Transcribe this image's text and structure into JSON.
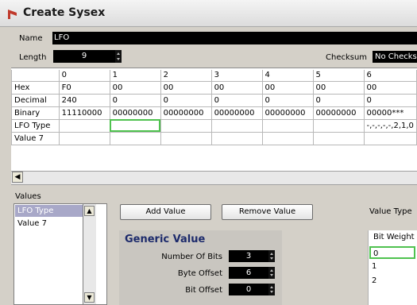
{
  "window": {
    "title": "Create Sysex"
  },
  "name": {
    "label": "Name",
    "value": "LFO"
  },
  "length": {
    "label": "Length",
    "value": "9"
  },
  "checksum": {
    "label": "Checksum",
    "value": "No Checksum"
  },
  "grid": {
    "columns": [
      "0",
      "1",
      "2",
      "3",
      "4",
      "5",
      "6"
    ],
    "rows": [
      {
        "label": "Hex",
        "cells": [
          "F0",
          "00",
          "00",
          "00",
          "00",
          "00",
          "00"
        ]
      },
      {
        "label": "Decimal",
        "cells": [
          "240",
          "0",
          "0",
          "0",
          "0",
          "0",
          "0"
        ]
      },
      {
        "label": "Binary",
        "cells": [
          "11110000",
          "00000000",
          "00000000",
          "00000000",
          "00000000",
          "00000000",
          "00000***"
        ]
      },
      {
        "label": "LFO Type",
        "cells": [
          "",
          "",
          "",
          "",
          "",
          "",
          "-,-,-,-,-,2,1,0"
        ]
      },
      {
        "label": "Value 7",
        "cells": [
          "",
          "",
          "",
          "",
          "",
          "",
          ""
        ]
      }
    ]
  },
  "values": {
    "label": "Values",
    "items": [
      "LFO Type",
      "Value 7"
    ]
  },
  "buttons": {
    "add": "Add Value",
    "remove": "Remove Value"
  },
  "value_type": {
    "label": "Value Type"
  },
  "generic": {
    "title": "Generic Value",
    "fields": [
      {
        "label": "Number Of Bits",
        "value": "3"
      },
      {
        "label": "Byte Offset",
        "value": "6"
      },
      {
        "label": "Bit Offset",
        "value": "0"
      }
    ]
  },
  "bit_weight": {
    "label": "Bit Weight",
    "items": [
      "0",
      "1",
      "2"
    ]
  },
  "colors": {
    "accent": "#4fc24f",
    "selection": "#a8a8c8",
    "field_bg": "#000000",
    "title_icon": "#c0392b"
  }
}
